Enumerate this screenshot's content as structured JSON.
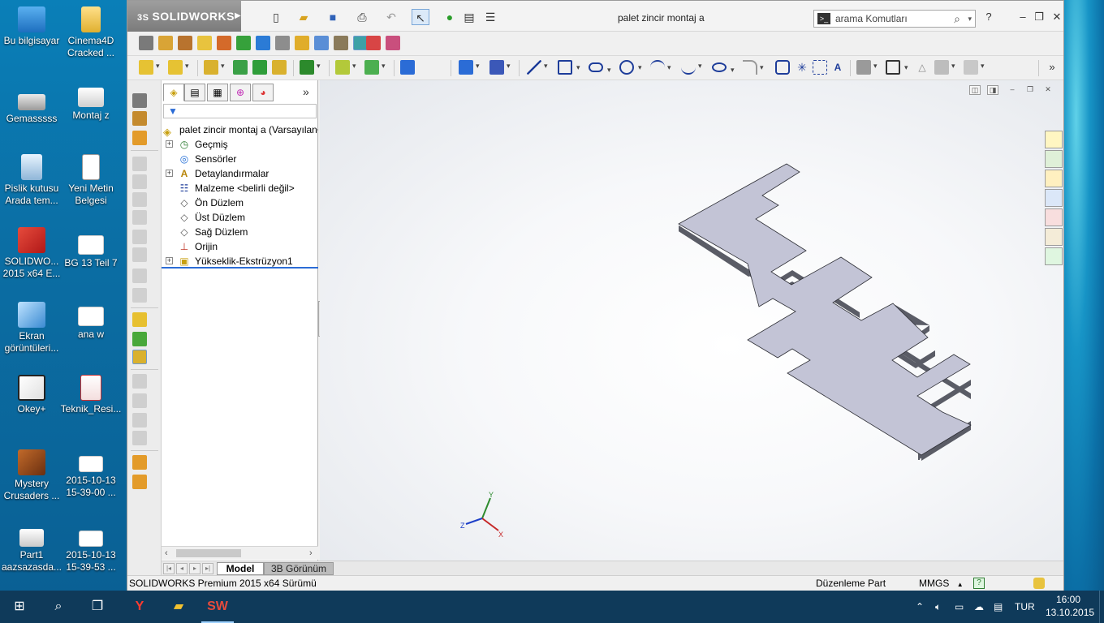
{
  "desktop": {
    "icons": [
      {
        "label": "Bu bilgisayar"
      },
      {
        "label": "Gemasssss"
      },
      {
        "label": "Pislik kutusu Arada tem..."
      },
      {
        "label": "SOLIDWO... 2015 x64 E..."
      },
      {
        "label": "Ekran görüntüleri..."
      },
      {
        "label": "Okey+"
      },
      {
        "label": "Mystery Crusaders ..."
      },
      {
        "label": "Part1 aazsazasda..."
      },
      {
        "label": "Cinema4D Cracked ..."
      },
      {
        "label": "Montaj z"
      },
      {
        "label": "Yeni Metin Belgesi"
      },
      {
        "label": "BG 13 Teil 7"
      },
      {
        "label": "ana w"
      },
      {
        "label": "Teknik_Resi..."
      },
      {
        "label": "2015-10-13 15-39-00 ..."
      },
      {
        "label": "2015-10-13 15-39-53 ..."
      }
    ]
  },
  "app": {
    "logo_text": "SOLIDWORKS",
    "logo_prefix": "3S",
    "title": "palet zincir montaj a",
    "search_placeholder": "arama Komutları",
    "help_label": "?"
  },
  "feature_manager": {
    "root_label": "palet zincir montaj a  (Varsayılan<<Varsayılan>_Gö",
    "items": [
      {
        "label": "Geçmiş",
        "expandable": true,
        "icon": "history-icon"
      },
      {
        "label": "Sensörler",
        "expandable": false,
        "icon": "sensor-icon"
      },
      {
        "label": "Detaylandırmalar",
        "expandable": true,
        "icon": "annotations-icon"
      },
      {
        "label": "Malzeme <belirli değil>",
        "expandable": false,
        "icon": "material-icon"
      },
      {
        "label": "Ön Düzlem",
        "expandable": false,
        "icon": "plane-icon"
      },
      {
        "label": "Üst Düzlem",
        "expandable": false,
        "icon": "plane-icon"
      },
      {
        "label": "Sağ Düzlem",
        "expandable": false,
        "icon": "plane-icon"
      },
      {
        "label": "Orijin",
        "expandable": false,
        "icon": "origin-icon"
      },
      {
        "label": "Yükseklik-Ekstrüzyon1",
        "expandable": true,
        "icon": "extrude-icon"
      }
    ]
  },
  "bottom_tabs": {
    "model": "Model",
    "view3d": "3B Görünüm"
  },
  "status": {
    "version": "SOLIDWORKS Premium 2015 x64 Sürümü",
    "mode": "Düzenleme Part",
    "units": "MMGS",
    "units_arrow": "▲",
    "help": "?"
  },
  "triad": {
    "x": "X",
    "y": "Y",
    "z": "Z"
  },
  "taskbar": {
    "language": "TUR",
    "time": "16:00",
    "date": "13.10.2015"
  },
  "colors": {
    "part_top": "#c3c4d6",
    "part_side": "#5a5c66",
    "part_edge": "#2e2f36",
    "accent": "#2b6cd6"
  }
}
